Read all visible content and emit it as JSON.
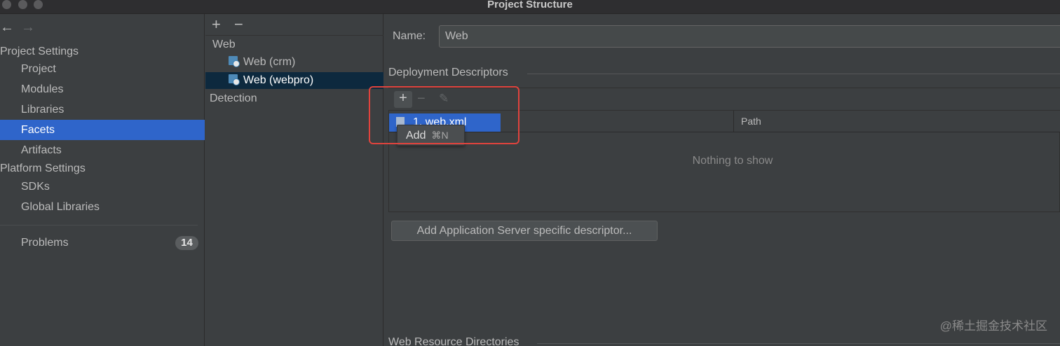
{
  "window": {
    "title": "Project Structure"
  },
  "nav": {
    "back": "←",
    "forward": "→"
  },
  "sidebar": {
    "project_settings_header": "Project Settings",
    "project_items": [
      {
        "label": "Project"
      },
      {
        "label": "Modules"
      },
      {
        "label": "Libraries"
      },
      {
        "label": "Facets",
        "selected": true
      },
      {
        "label": "Artifacts"
      }
    ],
    "platform_settings_header": "Platform Settings",
    "platform_items": [
      {
        "label": "SDKs"
      },
      {
        "label": "Global Libraries"
      }
    ],
    "problems": {
      "label": "Problems",
      "count": "14"
    }
  },
  "middle": {
    "add": "+",
    "remove": "−",
    "group": "Web",
    "items": [
      {
        "label": "Web (crm)"
      },
      {
        "label": "Web (webpro)",
        "selected": true
      }
    ],
    "detection": "Detection"
  },
  "content": {
    "name_label": "Name:",
    "name_value": "Web",
    "deployment_title": "Deployment Descriptors",
    "toolbar": {
      "add": "+",
      "remove": "−",
      "edit": "✎"
    },
    "table": {
      "columns": [
        "",
        "Path"
      ],
      "empty_text": "Nothing to show"
    },
    "popup_item": "1. web.xml",
    "tooltip": {
      "label": "Add",
      "shortcut": "⌘N"
    },
    "app_server_button": "Add Application Server specific descriptor...",
    "resource_dirs_title": "Web Resource Directories"
  },
  "watermark": "@稀土掘金技术社区",
  "colors": {
    "selection": "#2f65ca",
    "highlight_box": "#e0433d",
    "background": "#3c3f41"
  }
}
